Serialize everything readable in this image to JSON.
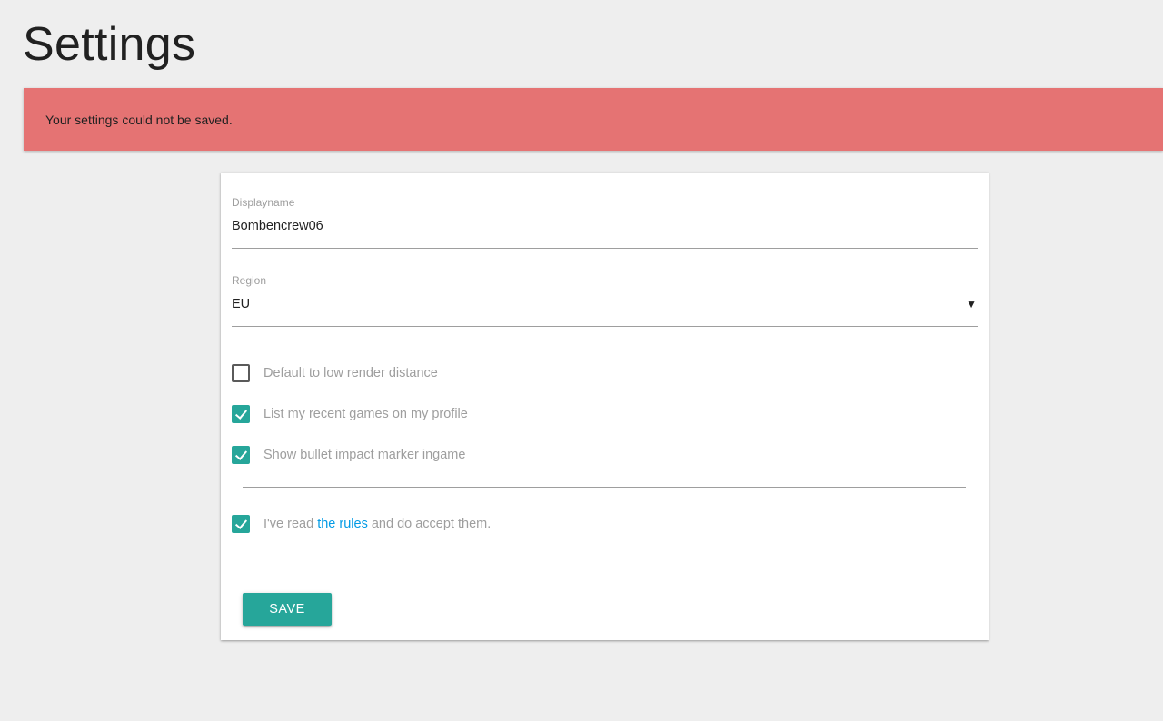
{
  "page": {
    "title": "Settings"
  },
  "alert": {
    "message": "Your settings could not be saved.",
    "color": "#e57373"
  },
  "form": {
    "displayname": {
      "label": "Displayname",
      "value": "Bombencrew06"
    },
    "region": {
      "label": "Region",
      "selected": "EU",
      "caret": "▼"
    },
    "options": [
      {
        "label": "Default to low render distance",
        "checked": false
      },
      {
        "label": "List my recent games on my profile",
        "checked": true
      },
      {
        "label": "Show bullet impact marker ingame",
        "checked": true
      }
    ],
    "rules": {
      "prefix": "I've read ",
      "link_text": "the rules",
      "suffix": " and do accept them.",
      "checked": true
    },
    "save_label": "SAVE"
  },
  "colors": {
    "accent": "#26a69a",
    "link": "#039be5",
    "background": "#eeeeee"
  }
}
